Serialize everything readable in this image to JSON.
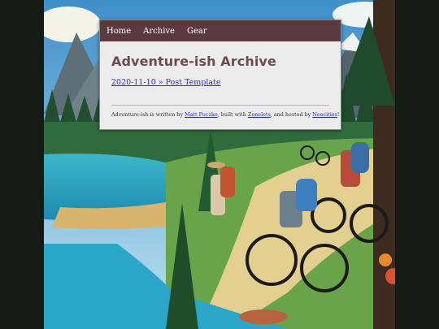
{
  "nav": {
    "items": [
      {
        "label": "Home"
      },
      {
        "label": "Archive"
      },
      {
        "label": "Gear"
      }
    ]
  },
  "site": {
    "title": "Adventure-ish Archive"
  },
  "posts": [
    {
      "label": "2020-11-10 » Post Template"
    }
  ],
  "footer": {
    "text_1": "Adventure-ish is written by ",
    "author_link": "Matt Puczko",
    "text_2": ", built with ",
    "builder_link": "Zonelets",
    "text_3": ", and hosted by ",
    "host_link": "Neocities",
    "text_4": "!"
  },
  "colors": {
    "nav_bar": "#5a3a3e",
    "title": "#6b4d50",
    "link": "#2a2ad6",
    "card_background": "#ececec",
    "page_background": "#141a14"
  }
}
